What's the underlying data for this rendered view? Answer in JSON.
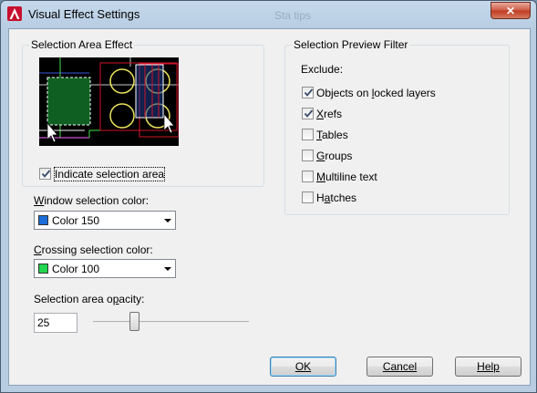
{
  "window": {
    "title": "Visual Effect Settings",
    "background_title": "Sta tips",
    "close_symbol": "✕"
  },
  "selection_area_effect": {
    "label": "Selection Area Effect",
    "indicate_label": "Indicate selection area",
    "indicate_checked": true
  },
  "window_color": {
    "label": "Window selection color:",
    "value": "Color 150",
    "swatch": "#1c6dd8"
  },
  "crossing_color": {
    "label": "Crossing selection color:",
    "value": "Color 100",
    "swatch": "#21d54e"
  },
  "opacity": {
    "label": "Selection area opacity:",
    "value": "25",
    "slider_level": 0.25
  },
  "preview_filter": {
    "label": "Selection Preview Filter",
    "exclude_label": "Exclude:",
    "items": [
      {
        "label": "Objects on locked layers",
        "checked": true
      },
      {
        "label": "Xrefs",
        "checked": true
      },
      {
        "label": "Tables",
        "checked": false
      },
      {
        "label": "Groups",
        "checked": false
      },
      {
        "label": "Multiline text",
        "checked": false
      },
      {
        "label": "Hatches",
        "checked": false
      }
    ]
  },
  "buttons": {
    "ok": "OK",
    "cancel": "Cancel",
    "help": "Help"
  },
  "colors": {
    "preview_background": "#000000",
    "window_fill": "#0f5f22",
    "frame_red": "#d0142a",
    "circle_yellow": "#ede45a"
  }
}
